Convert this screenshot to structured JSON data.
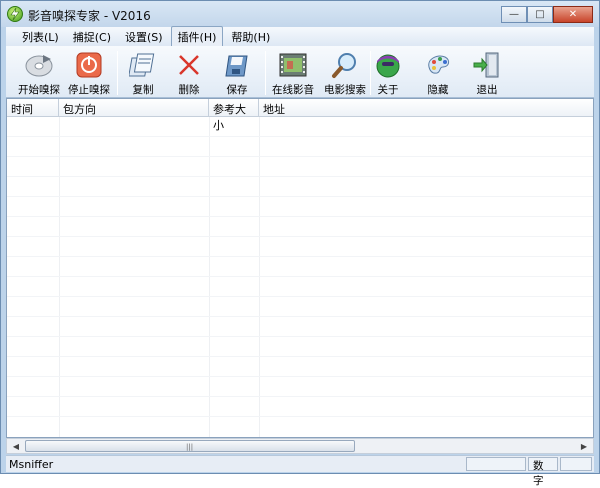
{
  "window": {
    "title": "影音嗅探专家 - V2016",
    "controls": {
      "minimize": "—",
      "maximize": "□",
      "close": "✕"
    }
  },
  "menu": [
    {
      "label": "列表(L)"
    },
    {
      "label": "捕捉(C)"
    },
    {
      "label": "设置(S)"
    },
    {
      "label": "插件(H)",
      "active": true
    },
    {
      "label": "帮助(H)"
    }
  ],
  "toolbar": {
    "start": "开始嗅探",
    "stop": "停止嗅探",
    "copy": "复制",
    "delete": "删除",
    "save": "保存",
    "online_video": "在线影音",
    "movie_search": "电影搜索",
    "about": "关于",
    "hide": "隐藏",
    "exit": "退出"
  },
  "columns": {
    "time": "时间",
    "direction": "包方向",
    "size": "参考大小",
    "address": "地址"
  },
  "rows": [],
  "scrollbar": {
    "left": "◀",
    "right": "▶",
    "grip": "|||"
  },
  "status": {
    "text": "Msniffer",
    "numlock": "数字"
  },
  "colors": {
    "titlebar": "#c3d6eb",
    "close_button": "#c8442a",
    "window_border": "#6c8db1"
  }
}
